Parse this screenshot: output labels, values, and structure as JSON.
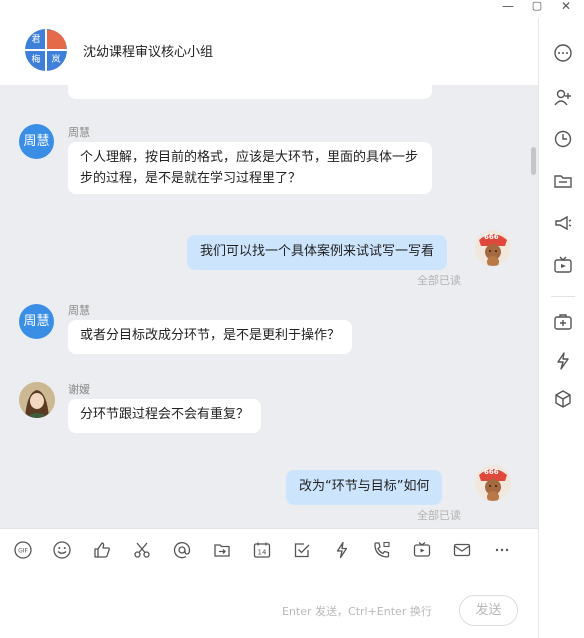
{
  "window": {
    "minimize_glyph": "—",
    "maximize_glyph": "▢",
    "close_glyph": "✕"
  },
  "header": {
    "group_name": "沈幼课程审议核心小组",
    "group_avatar": [
      "君",
      "",
      "梅",
      "岚"
    ]
  },
  "messages": {
    "m1": {
      "sender": "周慧",
      "avatar_text": "周慧",
      "text": "个人理解，按目前的格式，应该是大环节，里面的具体一步步的过程，是不是就在学习过程里了？"
    },
    "m2": {
      "text": "我们可以找一个具体案例来试试写一写看",
      "status": "全部已读",
      "avatar_badge": "666"
    },
    "m3": {
      "sender": "周慧",
      "avatar_text": "周慧",
      "text": "或者分目标改成分环节，是不是更利于操作？"
    },
    "m4": {
      "sender": "谢嫒",
      "text": "分环节跟过程会不会有重复？"
    },
    "m5": {
      "text": "改为“环节与目标”如何",
      "status": "全部已读",
      "avatar_badge": "666"
    }
  },
  "sidebar_icons": [
    "more-icon",
    "add-member-icon",
    "history-icon",
    "folder-icon",
    "announcement-icon",
    "live-icon",
    "app-add-icon",
    "lightning-icon",
    "cube-icon"
  ],
  "toolbar_icons": [
    "gif-icon",
    "emoji-icon",
    "thumbs-up-icon",
    "scissors-icon",
    "at-icon",
    "share-file-icon",
    "calendar-icon",
    "checkbox-icon",
    "lightning-icon",
    "phone-video-icon",
    "video-icon",
    "mail-icon",
    "more-icon"
  ],
  "input": {
    "hint": "Enter 发送，Ctrl+Enter 换行",
    "send_label": "发送"
  },
  "colors": {
    "chat_bg": "#ebedf0",
    "self_bubble": "#cce4fc",
    "avatar_blue": "#3a8ee6"
  }
}
